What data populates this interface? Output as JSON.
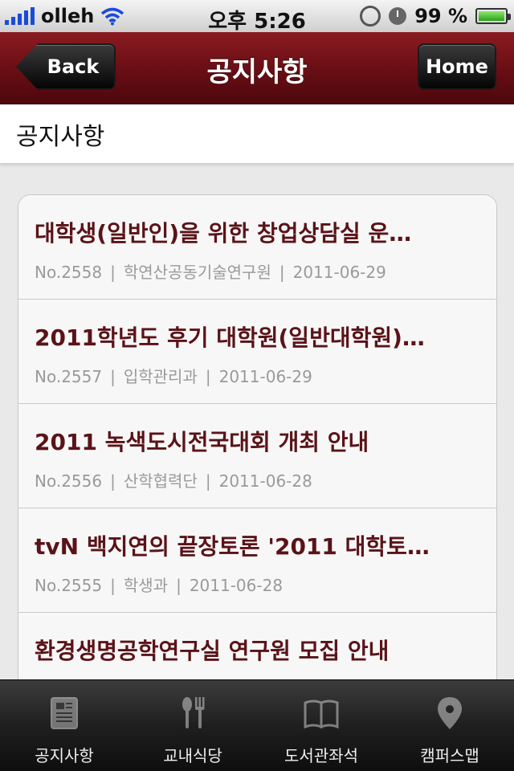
{
  "status_bar": {
    "carrier": "olleh",
    "time": "오후 5:26",
    "battery": "99 %",
    "battery_level": 0.99
  },
  "nav": {
    "back_label": "Back",
    "title": "공지사항",
    "home_label": "Home"
  },
  "section": {
    "title": "공지사항"
  },
  "notices": [
    {
      "title": "대학생(일반인)을 위한 창업상담실 운…",
      "no": "No.2558",
      "dept": "학연산공동기술연구원",
      "date": "2011-06-29"
    },
    {
      "title": "2011학년도 후기 대학원(일반대학원)…",
      "no": "No.2557",
      "dept": "입학관리과",
      "date": "2011-06-29"
    },
    {
      "title": "2011 녹색도시전국대회 개최 안내",
      "no": "No.2556",
      "dept": "산학협력단",
      "date": "2011-06-28"
    },
    {
      "title": "tvN 백지연의 끝장토론 '2011 대학토…",
      "no": "No.2555",
      "dept": "학생과",
      "date": "2011-06-28"
    },
    {
      "title": "환경생명공학연구실 연구원 모집 안내",
      "no": "",
      "dept": "",
      "date": ""
    }
  ],
  "tabs": [
    {
      "label": "공지사항",
      "icon": "notice-icon"
    },
    {
      "label": "교내식당",
      "icon": "fork-knife-icon"
    },
    {
      "label": "도서관좌석",
      "icon": "book-icon"
    },
    {
      "label": "캠퍼스맵",
      "icon": "map-pin-icon"
    }
  ],
  "colors": {
    "nav_red": "#6a0f15",
    "title_red": "#5a1318",
    "meta_gray": "#9a9a9a"
  }
}
